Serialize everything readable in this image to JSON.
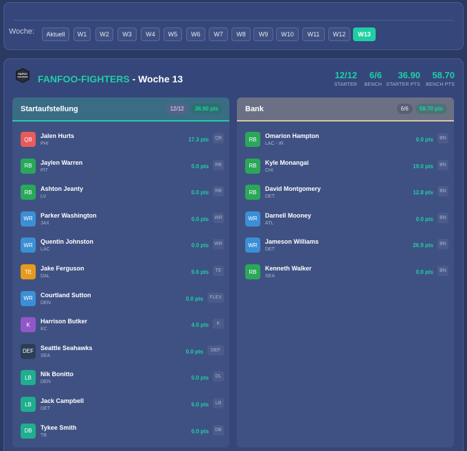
{
  "weeks": {
    "label": "Woche:",
    "buttons": [
      "Aktuell",
      "W1",
      "W2",
      "W3",
      "W4",
      "W5",
      "W6",
      "W7",
      "W8",
      "W9",
      "W10",
      "W11",
      "W12",
      "W13"
    ],
    "active": "W13"
  },
  "team": {
    "logo_text": "FANFOO FIGHTERS",
    "name": "FANFOO-FIGHTERS",
    "week_title": " - Woche 13",
    "stats": [
      {
        "value": "12/12",
        "label": "STARTER"
      },
      {
        "value": "6/6",
        "label": "BENCH"
      },
      {
        "value": "36.90",
        "label": "STARTER PTS"
      },
      {
        "value": "58.70",
        "label": "BENCH PTS"
      }
    ]
  },
  "starters": {
    "title": "Startaufstellung",
    "count": "12/12",
    "points": "36.90 pts",
    "players": [
      {
        "pos": "QB",
        "name": "Jalen Hurts",
        "team": "PHI",
        "pts": "17.3 pts",
        "slot": "QB"
      },
      {
        "pos": "RB",
        "name": "Jaylen Warren",
        "team": "PIT",
        "pts": "0.0 pts",
        "slot": "RB"
      },
      {
        "pos": "RB",
        "name": "Ashton Jeanty",
        "team": "LV",
        "pts": "0.0 pts",
        "slot": "RB"
      },
      {
        "pos": "WR",
        "name": "Parker Washington",
        "team": "JAX",
        "pts": "0.0 pts",
        "slot": "WR"
      },
      {
        "pos": "WR",
        "name": "Quentin Johnston",
        "team": "LAC",
        "pts": "0.0 pts",
        "slot": "WR"
      },
      {
        "pos": "TE",
        "name": "Jake Ferguson",
        "team": "DAL",
        "pts": "9.6 pts",
        "slot": "TE"
      },
      {
        "pos": "WR",
        "name": "Courtland Sutton",
        "team": "DEN",
        "pts": "0.0 pts",
        "slot": "FLEX"
      },
      {
        "pos": "K",
        "name": "Harrison Butker",
        "team": "KC",
        "pts": "4.0 pts",
        "slot": "K"
      },
      {
        "pos": "DEF",
        "name": "Seattle Seahawks",
        "team": "SEA",
        "pts": "0.0 pts",
        "slot": "DEF"
      },
      {
        "pos": "LB",
        "name": "Nik Bonitto",
        "team": "DEN",
        "pts": "0.0 pts",
        "slot": "DL"
      },
      {
        "pos": "LB",
        "name": "Jack Campbell",
        "team": "DET",
        "pts": "6.0 pts",
        "slot": "LB"
      },
      {
        "pos": "DB",
        "name": "Tykee Smith",
        "team": "TB",
        "pts": "0.0 pts",
        "slot": "DB"
      }
    ]
  },
  "bench": {
    "title": "Bank",
    "count": "6/6",
    "points": "58.70 pts",
    "players": [
      {
        "pos": "RB",
        "name": "Omarion Hampton",
        "team": "LAC - IR",
        "pts": "0.0 pts",
        "slot": "BN"
      },
      {
        "pos": "RB",
        "name": "Kyle Monangai",
        "team": "CHI",
        "pts": "19.0 pts",
        "slot": "BN"
      },
      {
        "pos": "RB",
        "name": "David Montgomery",
        "team": "DET",
        "pts": "12.8 pts",
        "slot": "BN"
      },
      {
        "pos": "WR",
        "name": "Darnell Mooney",
        "team": "ATL",
        "pts": "0.0 pts",
        "slot": "BN"
      },
      {
        "pos": "WR",
        "name": "Jameson Williams",
        "team": "DET",
        "pts": "26.9 pts",
        "slot": "BN"
      },
      {
        "pos": "RB",
        "name": "Kenneth Walker",
        "team": "SEA",
        "pts": "0.0 pts",
        "slot": "BN"
      }
    ]
  },
  "colors": {
    "accent": "#1fcfa3",
    "QB": "#e85b5b",
    "RB": "#2aa85a",
    "WR": "#3b8fd6",
    "TE": "#e69a1e",
    "K": "#9257c7",
    "DEF": "#2c3e55",
    "LB": "#1fae8e",
    "DB": "#1fae8e"
  }
}
